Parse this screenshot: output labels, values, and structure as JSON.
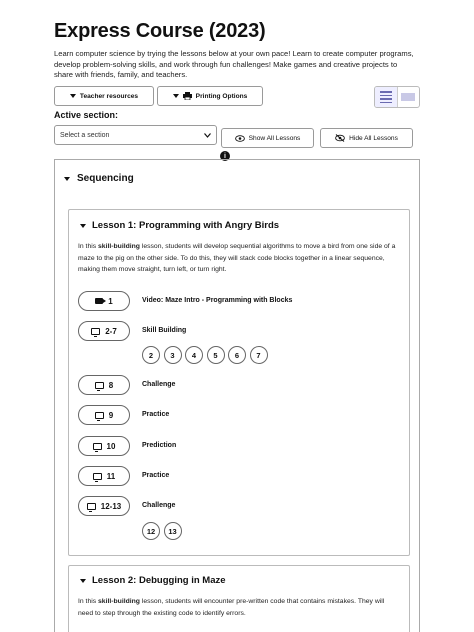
{
  "page": {
    "title": "Express Course (2023)",
    "description": "Learn computer science by trying the lessons below at your own pace! Learn to create computer programs, develop problem-solving skills, and work through fun challenges! Make games and creative projects to share with friends, family, and teachers."
  },
  "toolbar": {
    "teacher_resources": "Teacher resources",
    "printing_options": "Printing Options",
    "view_modes": [
      "list",
      "grid"
    ],
    "selected_view": "list"
  },
  "section_controls": {
    "active_label": "Active section:",
    "select_placeholder": "Select a section",
    "show_all": "Show All Lessons",
    "hide_all": "Hide All Lessons",
    "info": "i"
  },
  "section": {
    "name": "Sequencing",
    "lessons": [
      {
        "title": "Lesson 1: Programming with Angry Birds",
        "desc_prefix": "In this ",
        "desc_bold": "skill-building",
        "desc_rest": " lesson, students will develop sequential algorithms to move a bird from one side of a maze to the pig on the other side. To do this, they will stack code blocks together in a linear sequence, making them move straight, turn left, or turn right.",
        "activities": [
          {
            "icon": "video-icon",
            "num": "1",
            "label": "Video: Maze Intro - Programming with Blocks"
          },
          {
            "icon": "monitor-icon",
            "num": "2-7",
            "label": "Skill Building",
            "levels": [
              "2",
              "3",
              "4",
              "5",
              "6",
              "7"
            ]
          },
          {
            "icon": "monitor-icon",
            "num": "8",
            "label": "Challenge"
          },
          {
            "icon": "monitor-icon",
            "num": "9",
            "label": "Practice"
          },
          {
            "icon": "monitor-icon",
            "num": "10",
            "label": "Prediction"
          },
          {
            "icon": "monitor-icon",
            "num": "11",
            "label": "Practice"
          },
          {
            "icon": "monitor-icon",
            "num": "12-13",
            "label": "Challenge",
            "levels": [
              "12",
              "13"
            ]
          }
        ]
      },
      {
        "title": "Lesson 2: Debugging in Maze",
        "desc_prefix": "In this ",
        "desc_bold": "skill-building",
        "desc_rest": " lesson, students will encounter pre-written code that contains mistakes. They will need to step through the existing code to identify errors."
      }
    ]
  }
}
